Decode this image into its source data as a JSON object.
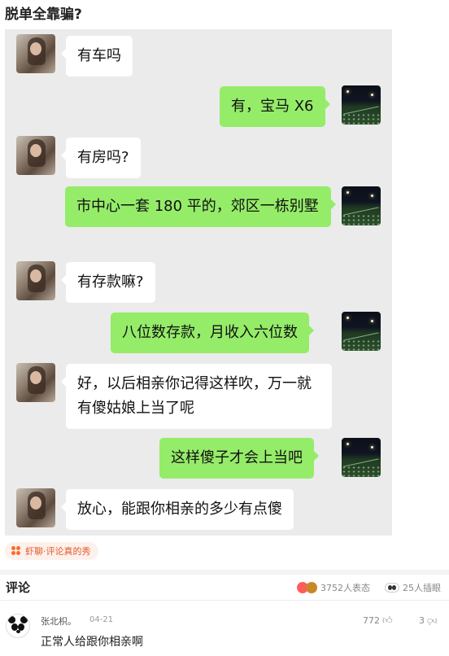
{
  "post": {
    "title": "脱单全靠骗?"
  },
  "chat": {
    "messages": [
      {
        "side": "left",
        "text": "有车吗"
      },
      {
        "side": "right",
        "text": "有，宝马 X6"
      },
      {
        "side": "left",
        "text": "有房吗?"
      },
      {
        "side": "right",
        "text": "市中心一套 180 平的，郊区一栋别墅"
      },
      {
        "side": "left",
        "text": "有存款嘛?"
      },
      {
        "side": "right",
        "text": "八位数存款，月收入六位数"
      },
      {
        "side": "left",
        "text": "好，以后相亲你记得这样吹，万一就有傻姑娘上当了呢"
      },
      {
        "side": "right",
        "text": "这样傻子才会上当吧"
      },
      {
        "side": "left",
        "text": "放心，能跟你相亲的多少有点傻"
      }
    ]
  },
  "tag": {
    "label": "虾聊·评论真的秀",
    "icon": "flower-icon",
    "color": "#e05a2b"
  },
  "comments": {
    "title": "评论",
    "reactions": "3752人表态",
    "plug_count": "25人插眼",
    "items": [
      {
        "name": "张北枳。",
        "time": "04-21",
        "text": "正常人给跟你相亲啊",
        "likes": "772",
        "replies": "3"
      }
    ]
  },
  "colors": {
    "bubble_green": "#95ec69",
    "chat_bg": "#ebebeb"
  }
}
